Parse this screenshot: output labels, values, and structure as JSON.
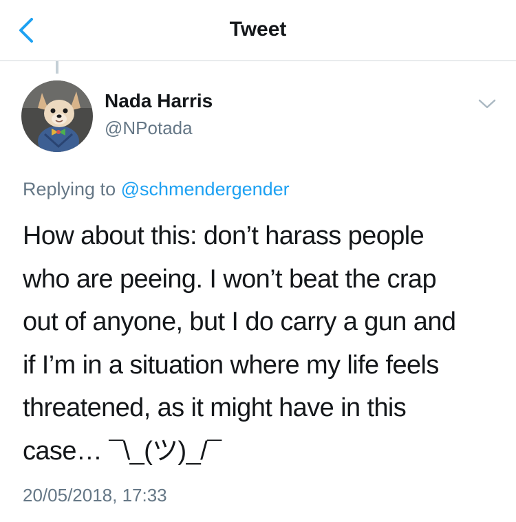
{
  "nav": {
    "title": "Tweet",
    "back_icon": "chevron-left-icon",
    "accent_color": "#1da1f2"
  },
  "tweet": {
    "author": {
      "name": "Nada Harris",
      "handle": "@NPotada",
      "avatar_icon": "dog-avatar"
    },
    "replying_prefix": "Replying to",
    "replying_to": "@schmendergender",
    "text_lines": [
      "How about this: don’t harass people",
      "who are peeing. I won’t beat the crap",
      "out of anyone, but I do carry a gun and",
      "if I’m in a situation where my life feels",
      "threatened, as it might have in this",
      "case… ¯\\_(ツ)_/¯"
    ],
    "timestamp": "20/05/2018, 17:33",
    "menu_icon": "chevron-down-icon"
  },
  "colors": {
    "text_primary": "#14171a",
    "text_secondary": "#657786",
    "link": "#1da1f2",
    "divider": "#cfd4d8"
  }
}
